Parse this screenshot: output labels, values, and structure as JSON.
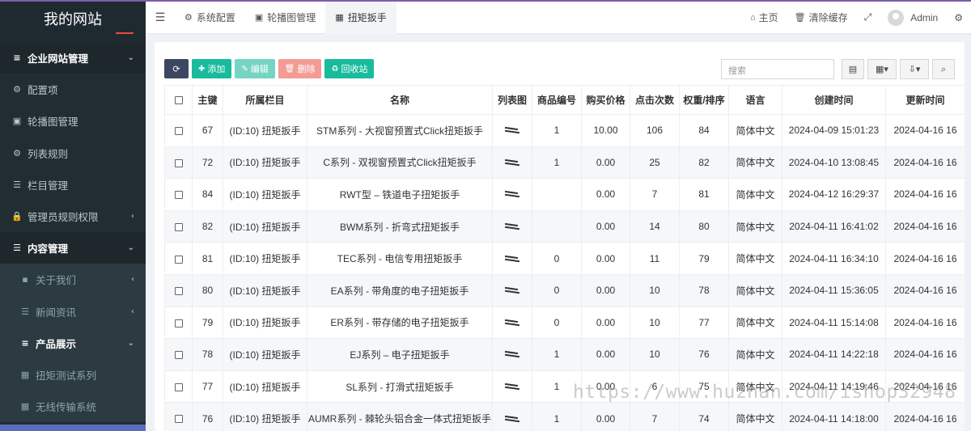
{
  "sidebar": {
    "brand": "我的网站",
    "items": [
      {
        "label": "企业网站管理",
        "icon": "bars-icon",
        "level": "head",
        "caret": "⌄"
      },
      {
        "label": "配置项",
        "icon": "cogs-icon",
        "level": "normal",
        "caret": ""
      },
      {
        "label": "轮播图管理",
        "icon": "image-icon",
        "level": "normal",
        "caret": ""
      },
      {
        "label": "列表规则",
        "icon": "gear-icon",
        "level": "normal",
        "caret": ""
      },
      {
        "label": "栏目管理",
        "icon": "list-icon",
        "level": "normal",
        "caret": ""
      },
      {
        "label": "管理员规则权限",
        "icon": "lock-icon",
        "level": "normal",
        "caret": "‹"
      },
      {
        "label": "内容管理",
        "icon": "list-icon",
        "level": "head",
        "caret": "⌄"
      },
      {
        "label": "关于我们",
        "icon": "user-card-icon",
        "level": "sub",
        "caret": "‹"
      },
      {
        "label": "新闻资讯",
        "icon": "list-icon",
        "level": "sub",
        "caret": "‹"
      },
      {
        "label": "产品展示",
        "icon": "bars-icon",
        "level": "sub2",
        "caret": "⌄"
      },
      {
        "label": "扭矩测试系列",
        "icon": "grid-icon",
        "level": "sub3",
        "caret": ""
      },
      {
        "label": "无线传输系统",
        "icon": "grid-icon",
        "level": "sub3",
        "caret": ""
      }
    ]
  },
  "topnav": {
    "tabs": [
      {
        "label": "系统配置",
        "icon": "gear-icon"
      },
      {
        "label": "轮播图管理",
        "icon": "image-icon"
      },
      {
        "label": "扭矩扳手",
        "icon": "grid-icon"
      }
    ],
    "home": "主页",
    "clear_cache": "清除缓存",
    "user": "Admin"
  },
  "toolbar": {
    "add": "添加",
    "edit": "编辑",
    "delete": "删除",
    "recycle": "回收站",
    "search_placeholder": "搜索"
  },
  "table": {
    "columns": [
      "主键",
      "所属栏目",
      "名称",
      "列表图",
      "商品编号",
      "购买价格",
      "点击次数",
      "权重/排序",
      "语言",
      "创建时间",
      "更新时间"
    ],
    "rows": [
      {
        "id": "67",
        "category": "(ID:10) 扭矩扳手",
        "name": "STM系列 - 大视窗预置式Click扭矩扳手",
        "code": "1",
        "price": "10.00",
        "clicks": "106",
        "weight": "84",
        "lang": "简体中文",
        "created": "2024-04-09 15:01:23",
        "updated": "2024-04-16 16"
      },
      {
        "id": "72",
        "category": "(ID:10) 扭矩扳手",
        "name": "C系列 - 双视窗预置式Click扭矩扳手",
        "code": "1",
        "price": "0.00",
        "clicks": "25",
        "weight": "82",
        "lang": "简体中文",
        "created": "2024-04-10 13:08:45",
        "updated": "2024-04-16 16"
      },
      {
        "id": "84",
        "category": "(ID:10) 扭矩扳手",
        "name": "RWT型 – 铁道电子扭矩扳手",
        "code": "",
        "price": "0.00",
        "clicks": "7",
        "weight": "81",
        "lang": "简体中文",
        "created": "2024-04-12 16:29:37",
        "updated": "2024-04-16 16"
      },
      {
        "id": "82",
        "category": "(ID:10) 扭矩扳手",
        "name": "BWM系列 - 折弯式扭矩扳手",
        "code": "",
        "price": "0.00",
        "clicks": "14",
        "weight": "80",
        "lang": "简体中文",
        "created": "2024-04-11 16:41:02",
        "updated": "2024-04-16 16"
      },
      {
        "id": "81",
        "category": "(ID:10) 扭矩扳手",
        "name": "TEC系列 - 电信专用扭矩扳手",
        "code": "0",
        "price": "0.00",
        "clicks": "11",
        "weight": "79",
        "lang": "简体中文",
        "created": "2024-04-11 16:34:10",
        "updated": "2024-04-16 16"
      },
      {
        "id": "80",
        "category": "(ID:10) 扭矩扳手",
        "name": "EA系列 - 带角度的电子扭矩扳手",
        "code": "0",
        "price": "0.00",
        "clicks": "10",
        "weight": "78",
        "lang": "简体中文",
        "created": "2024-04-11 15:36:05",
        "updated": "2024-04-16 16"
      },
      {
        "id": "79",
        "category": "(ID:10) 扭矩扳手",
        "name": "ER系列 - 带存储的电子扭矩扳手",
        "code": "0",
        "price": "0.00",
        "clicks": "10",
        "weight": "77",
        "lang": "简体中文",
        "created": "2024-04-11 15:14:08",
        "updated": "2024-04-16 16"
      },
      {
        "id": "78",
        "category": "(ID:10) 扭矩扳手",
        "name": "EJ系列 – 电子扭矩扳手",
        "code": "1",
        "price": "0.00",
        "clicks": "10",
        "weight": "76",
        "lang": "简体中文",
        "created": "2024-04-11 14:22:18",
        "updated": "2024-04-16 16"
      },
      {
        "id": "77",
        "category": "(ID:10) 扭矩扳手",
        "name": "SL系列 - 打滑式扭矩扳手",
        "code": "1",
        "price": "0.00",
        "clicks": "6",
        "weight": "75",
        "lang": "简体中文",
        "created": "2024-04-11 14:19:46",
        "updated": "2024-04-16 16"
      },
      {
        "id": "76",
        "category": "(ID:10) 扭矩扳手",
        "name": "AUMR系列 - 棘轮头铝合金一体式扭矩扳手",
        "code": "1",
        "price": "0.00",
        "clicks": "7",
        "weight": "74",
        "lang": "简体中文",
        "created": "2024-04-11 14:18:00",
        "updated": "2024-04-16 16"
      }
    ]
  },
  "watermark": "https://www.huzhan.com/ishop32948",
  "colors": {
    "sidebar_bg": "#222d32",
    "accent": "#18bc9c",
    "refresh": "#3c4761",
    "danger": "#f49b95"
  }
}
